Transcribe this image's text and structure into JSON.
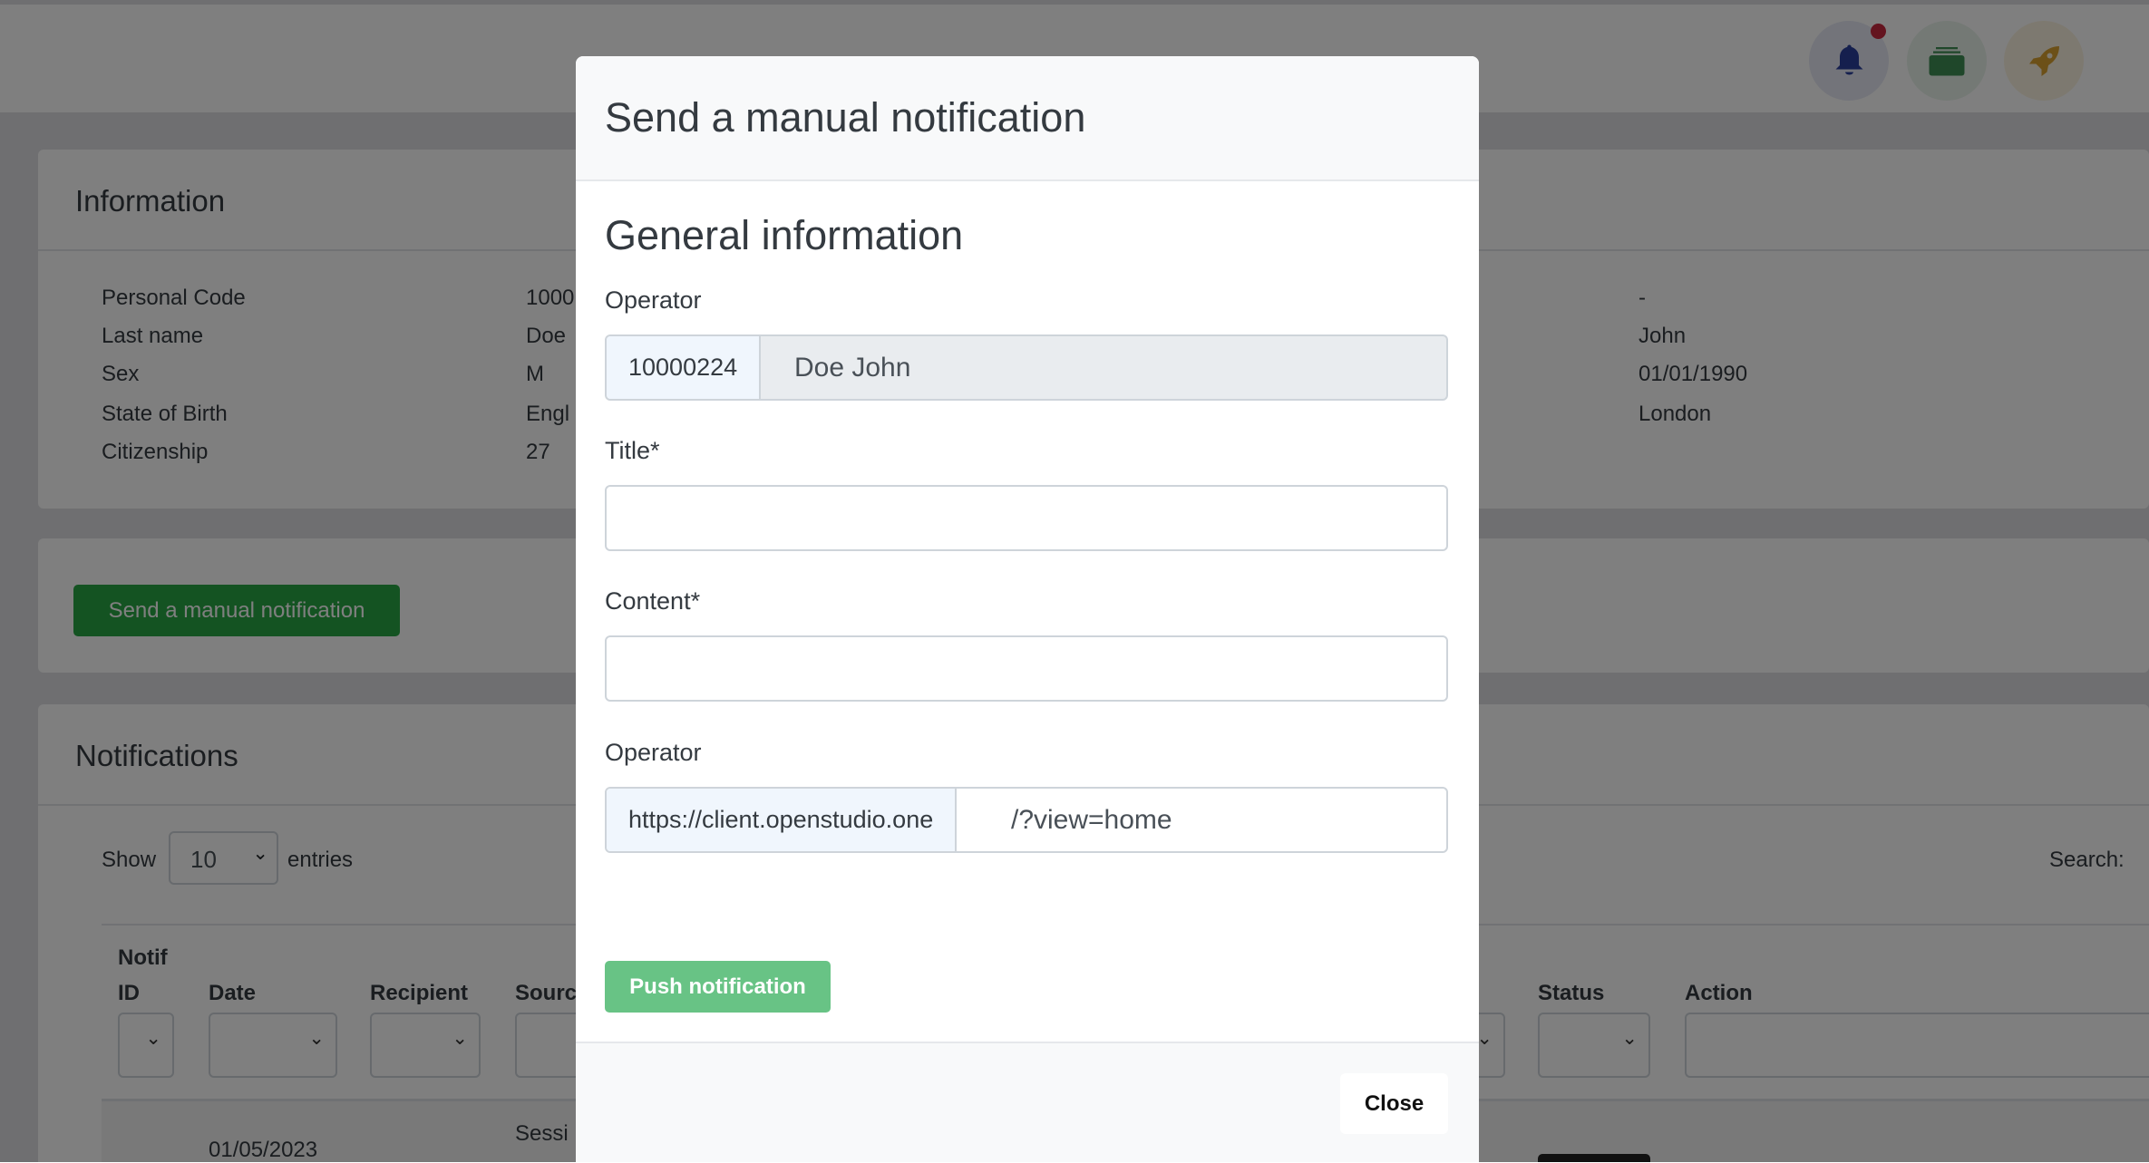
{
  "header": {
    "icons": [
      "bell-icon",
      "wallet-icon",
      "rocket-icon"
    ],
    "colors": {
      "bell": "#2a3f9d",
      "wallet": "#3f8f55",
      "rocket": "#d8a030",
      "badge": "#c8283e"
    }
  },
  "information": {
    "title": "Information",
    "left": [
      {
        "label": "Personal Code",
        "value": "1000"
      },
      {
        "label": "Last name",
        "value": "Doe"
      },
      {
        "label": "Sex",
        "value": "M"
      },
      {
        "label": "State of Birth",
        "value": "Engl"
      },
      {
        "label": "Citizenship",
        "value": "27"
      }
    ],
    "right": [
      "-",
      "John",
      "01/01/1990",
      "London"
    ]
  },
  "send_button": "Send a manual notification",
  "notifications": {
    "title": "Notifications",
    "show": "Show",
    "entries_value": "10",
    "entries": "entries",
    "search": "Search:",
    "columns": {
      "notif": "Notif",
      "id": "ID",
      "date": "Date",
      "recipient": "Recipient",
      "source": "Sourc",
      "status": "Status",
      "action": "Action"
    },
    "row": {
      "date": "01/05/2023",
      "source": "Sessi"
    }
  },
  "modal": {
    "title": "Send a manual notification",
    "section": "General information",
    "operator_label": "Operator",
    "operator_code": "10000224",
    "operator_name": "Doe John",
    "title_label": "Title*",
    "title_value": "",
    "content_label": "Content*",
    "content_value": "",
    "link_label": "Operator",
    "link_prefix": "https://client.openstudio.one",
    "link_value": "/?view=home",
    "push": "Push notification",
    "close": "Close"
  },
  "colors": {
    "primary_green": "#28a745"
  }
}
